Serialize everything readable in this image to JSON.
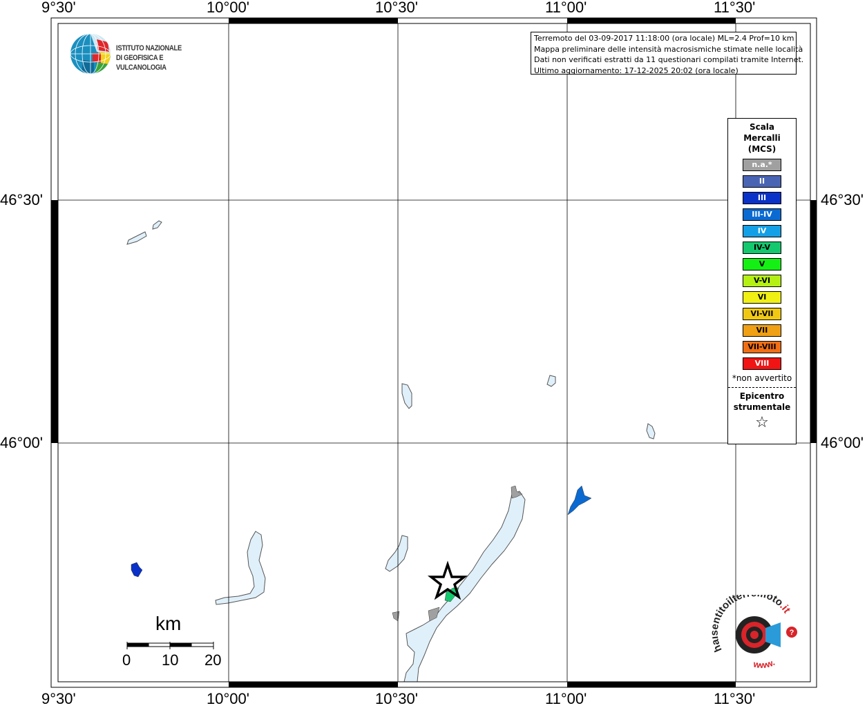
{
  "map": {
    "lon_labels": [
      "9°30'",
      "10°00'",
      "10°30'",
      "11°00'",
      "11°30'"
    ],
    "lat_labels": [
      "46°30'",
      "46°00'"
    ]
  },
  "info": {
    "line1": "Terremoto del 03-09-2017 11:18:00 (ora locale) ML=2.4 Prof=10 km",
    "line2": "Mappa preliminare delle intensità macrosismiche stimate nelle località",
    "line3": "Dati non verificati estratti da 11 questionari compilati tramite Internet.",
    "line4": "Ultimo aggiornamento: 17-12-2025 20:02 (ora locale)"
  },
  "logo": {
    "line1": "ISTITUTO NAZIONALE",
    "line2": "DI GEOFISICA E VULCANOLOGIA"
  },
  "legend": {
    "title_line1": "Scala",
    "title_line2": "Mercalli",
    "title_line3": "(MCS)",
    "items": [
      {
        "label": "n.a.*",
        "color": "#a0a0a0",
        "text_color": "#ffffff"
      },
      {
        "label": "II",
        "color": "#4a64b4",
        "text_color": "#ffffff"
      },
      {
        "label": "III",
        "color": "#0a32c8",
        "text_color": "#ffffff"
      },
      {
        "label": "III-IV",
        "color": "#0a6ad2",
        "text_color": "#ffffff"
      },
      {
        "label": "IV",
        "color": "#14a0e6",
        "text_color": "#ffffff"
      },
      {
        "label": "IV-V",
        "color": "#14c86e",
        "text_color": "#000000"
      },
      {
        "label": "V",
        "color": "#14f014",
        "text_color": "#000000"
      },
      {
        "label": "V-VI",
        "color": "#b4f014",
        "text_color": "#000000"
      },
      {
        "label": "VI",
        "color": "#f0f014",
        "text_color": "#000000"
      },
      {
        "label": "VI-VII",
        "color": "#f0c814",
        "text_color": "#000000"
      },
      {
        "label": "VII",
        "color": "#f0a014",
        "text_color": "#000000"
      },
      {
        "label": "VII-VIII",
        "color": "#f06e14",
        "text_color": "#000000"
      },
      {
        "label": "VIII",
        "color": "#f01414",
        "text_color": "#ffffff"
      }
    ],
    "note": "*non avvertito",
    "epicenter_line1": "Epicentro",
    "epicenter_line2": "strumentale"
  },
  "scale": {
    "unit": "km",
    "labels": [
      "0",
      "10",
      "20"
    ]
  },
  "watermark": {
    "text_dark": "haisentitoilterremoto",
    "text_red": ".it",
    "text_bottom": "www."
  }
}
